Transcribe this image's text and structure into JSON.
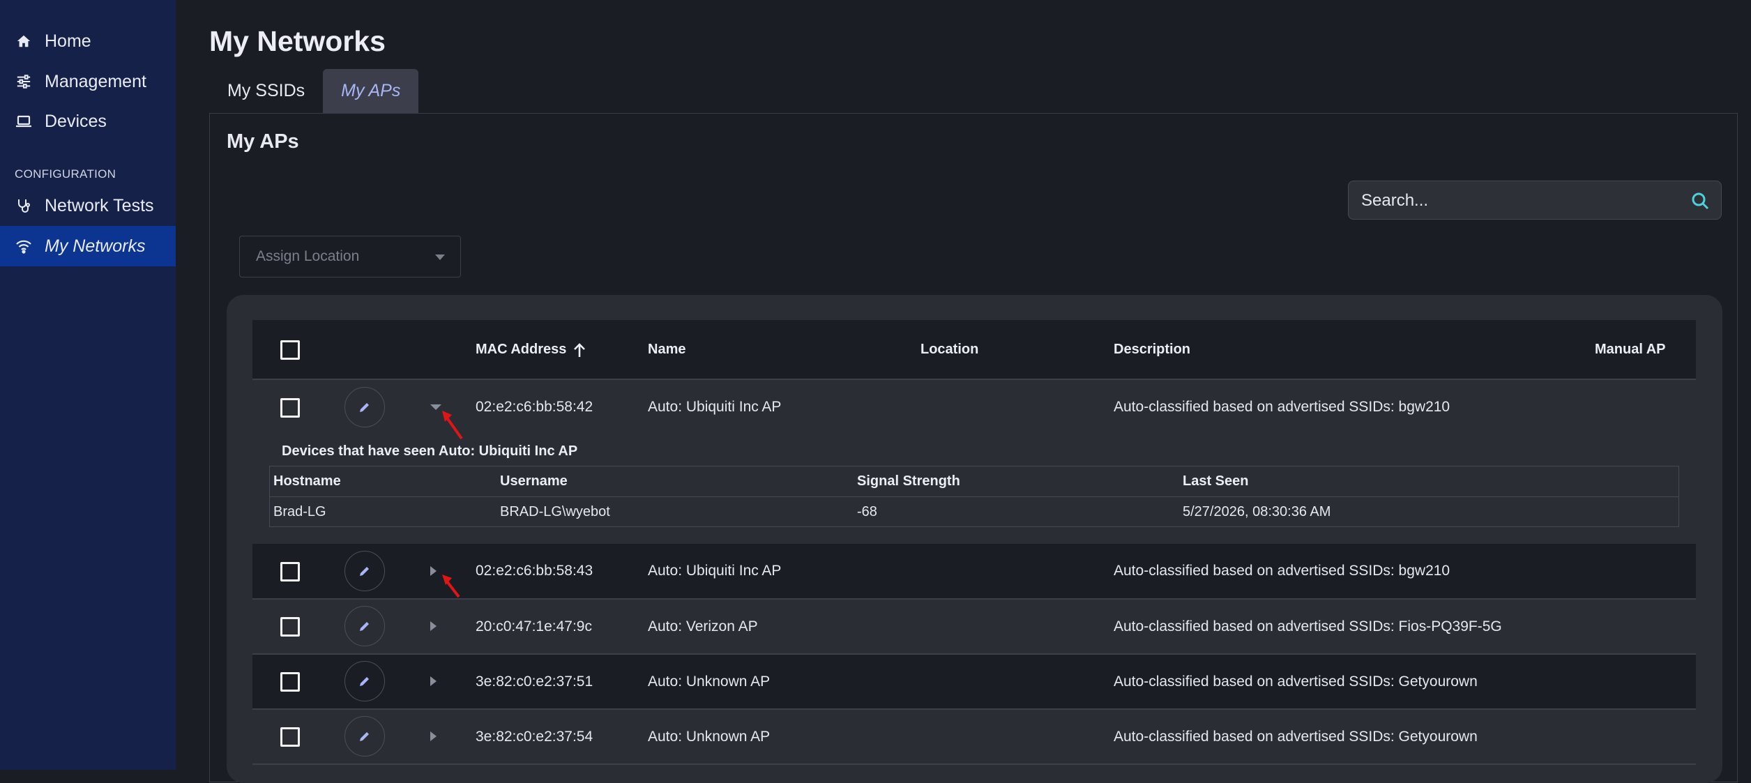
{
  "sidebar": {
    "items": [
      {
        "label": "Home",
        "icon": "home-icon"
      },
      {
        "label": "Management",
        "icon": "sliders-icon"
      },
      {
        "label": "Devices",
        "icon": "laptop-icon"
      }
    ],
    "section_label": "CONFIGURATION",
    "config_items": [
      {
        "label": "Network Tests",
        "icon": "stethoscope-icon"
      },
      {
        "label": "My Networks",
        "icon": "wifi-icon",
        "active": true
      }
    ]
  },
  "page": {
    "title": "My Networks",
    "tabs": [
      {
        "label": "My SSIDs",
        "active": false
      },
      {
        "label": "My APs",
        "active": true
      }
    ],
    "panel_title": "My APs"
  },
  "search": {
    "placeholder": "Search..."
  },
  "assign_location": {
    "label": "Assign Location"
  },
  "table": {
    "headers": {
      "mac": "MAC Address",
      "name": "Name",
      "location": "Location",
      "description": "Description",
      "manual": "Manual AP"
    },
    "rows": [
      {
        "mac": "02:e2:c6:bb:58:42",
        "name": "Auto: Ubiquiti Inc AP",
        "location": "",
        "description": "Auto-classified based on advertised SSIDs: bgw210",
        "expanded": true
      },
      {
        "mac": "02:e2:c6:bb:58:43",
        "name": "Auto: Ubiquiti Inc AP",
        "location": "",
        "description": "Auto-classified based on advertised SSIDs: bgw210",
        "expanded": false
      },
      {
        "mac": "20:c0:47:1e:47:9c",
        "name": "Auto: Verizon AP",
        "location": "",
        "description": "Auto-classified based on advertised SSIDs: Fios-PQ39F-5G",
        "expanded": false
      },
      {
        "mac": "3e:82:c0:e2:37:51",
        "name": "Auto: Unknown AP",
        "location": "",
        "description": "Auto-classified based on advertised SSIDs: Getyourown",
        "expanded": false
      },
      {
        "mac": "3e:82:c0:e2:37:54",
        "name": "Auto: Unknown AP",
        "location": "",
        "description": "Auto-classified based on advertised SSIDs: Getyourown",
        "expanded": false
      }
    ],
    "detail": {
      "title": "Devices that have seen Auto: Ubiquiti Inc AP",
      "headers": {
        "hostname": "Hostname",
        "username": "Username",
        "signal": "Signal Strength",
        "last_seen": "Last Seen"
      },
      "rows": [
        {
          "hostname": "Brad-LG",
          "username": "BRAD-LG\\wyebot",
          "signal": "-68",
          "last_seen": "5/27/2026, 08:30:36 AM"
        }
      ]
    }
  },
  "colors": {
    "sidebar_bg": "#16214a",
    "sidebar_active": "#0b3590",
    "page_bg": "#1b1d25",
    "table_bg": "#2b2d35",
    "accent_tab": "#a9b6f6",
    "search_icon": "#4fd1d9",
    "annotation_arrow": "#e01515"
  }
}
